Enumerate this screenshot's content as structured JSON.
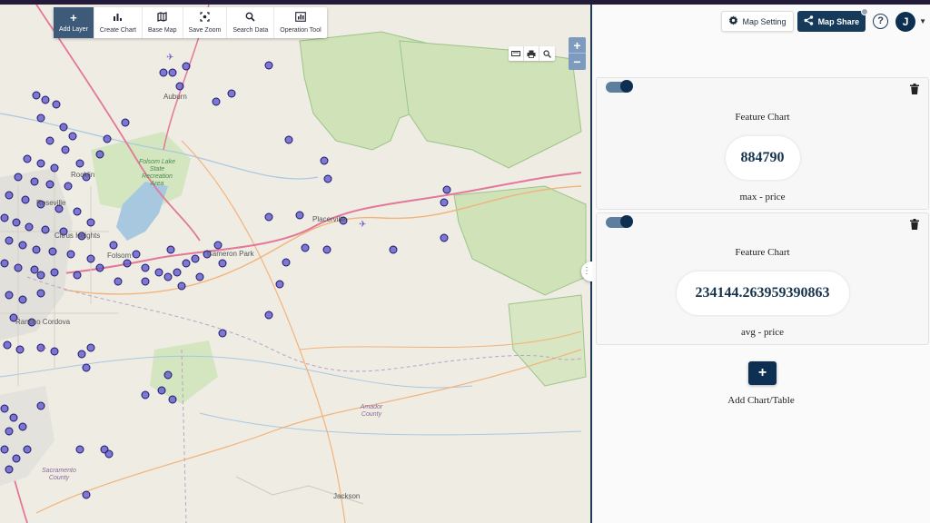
{
  "toolbar": {
    "add_layer": "Add Layer",
    "create_chart": "Create Chart",
    "base_map": "Base Map",
    "save_zoom": "Save Zoom",
    "search_data": "Search Data",
    "operation_tool": "Operation Tool"
  },
  "map": {
    "places": {
      "auburn": "Auburn",
      "rocklin": "Rocklin",
      "roseville": "Roseville",
      "citrus_heights": "Citrus Heights",
      "folsom": "Folsom",
      "cameron_park": "Cameron Park",
      "placerville": "Placerville",
      "rancho_cordova": "Rancho Cordova",
      "jackson": "Jackson",
      "folsom_lake": "Folsom Lake State Recreation Area",
      "amador_county": "Amador County",
      "sacramento_county": "Sacramento County"
    },
    "zoom_in": "+",
    "zoom_out": "−"
  },
  "panel": {
    "map_setting": "Map Setting",
    "map_share": "Map Share",
    "help": "?",
    "avatar_initial": "J",
    "cards": [
      {
        "title": "Feature Chart",
        "value": "884790",
        "subtitle": "max - price"
      },
      {
        "title": "Feature Chart",
        "value": "234144.263959390863",
        "subtitle": "avg - price"
      }
    ],
    "add_label": "Add Chart/Table"
  }
}
